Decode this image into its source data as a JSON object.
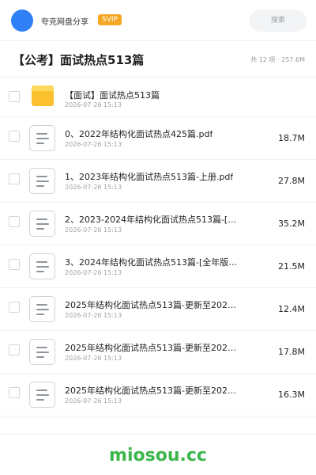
{
  "header": {
    "app_title": "夸克网盘分享",
    "badge": "SVIP",
    "search_placeholder": "搜索"
  },
  "folder": {
    "title": "【公考】面试热点513篇",
    "meta": "共 12 项 · 257.6M"
  },
  "items": [
    {
      "type": "folder",
      "name": "【面试】面试热点513篇",
      "date": "2026-07-26 15:13",
      "size": ""
    },
    {
      "type": "file",
      "name": "0、2022年结构化面试热点425篇.pdf",
      "date": "2026-07-26 15:13",
      "size": "18.7M"
    },
    {
      "type": "file",
      "name": "1、2023年结构化面试热点513篇-上册.pdf",
      "date": "2026-07-26 15:13",
      "size": "27.8M"
    },
    {
      "type": "file",
      "name": "2、2023-2024年结构化面试热点513篇-[…",
      "date": "2026-07-26 15:13",
      "size": "35.2M"
    },
    {
      "type": "file",
      "name": "3、2024年结构化面试热点513篇-[全年版]-…",
      "date": "2026-07-26 15:13",
      "size": "21.5M"
    },
    {
      "type": "file",
      "name": "2025年结构化面试热点513篇-更新至2025…",
      "date": "2026-07-26 15:13",
      "size": "12.4M"
    },
    {
      "type": "file",
      "name": "2025年结构化面试热点513篇-更新至2025…",
      "date": "2026-07-26 15:13",
      "size": "17.8M"
    },
    {
      "type": "file",
      "name": "2025年结构化面试热点513篇-更新至2025…",
      "date": "2026-07-26 15:13",
      "size": "16.3M"
    }
  ],
  "footer": {
    "brand": "miosou.cc"
  },
  "colors": {
    "accent_blue": "#2f80f7",
    "svip_orange": "#f5a623",
    "folder_yellow": "#fbc02d",
    "brand_green": "#3cb54a"
  }
}
